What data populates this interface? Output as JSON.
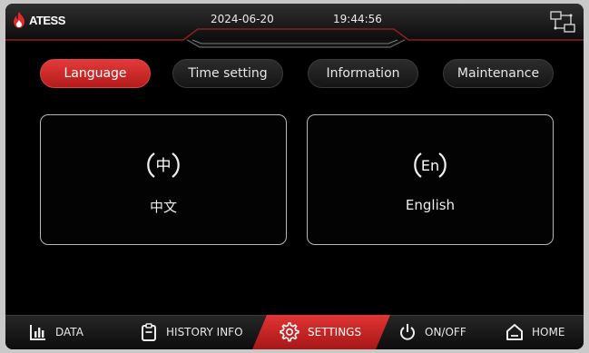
{
  "app": {
    "logo_text": "ATESS"
  },
  "status": {
    "date": "2024-06-20",
    "time": "19:44:56"
  },
  "icons": {
    "logo": "flame-icon",
    "network": "network-icon"
  },
  "tabs": [
    {
      "label": "Language",
      "active": true
    },
    {
      "label": "Time setting",
      "active": false
    },
    {
      "label": "Information",
      "active": false
    },
    {
      "label": "Maintenance",
      "active": false
    }
  ],
  "languages": [
    {
      "glyph": "中",
      "label": "中文"
    },
    {
      "glyph": "En",
      "label": "English"
    }
  ],
  "nav": [
    {
      "label": "DATA",
      "icon": "bar-chart-icon"
    },
    {
      "label": "HISTORY INFO",
      "icon": "clipboard-icon"
    },
    {
      "label": "SETTINGS",
      "icon": "gear-icon",
      "active": true
    },
    {
      "label": "ON/OFF",
      "icon": "power-icon"
    },
    {
      "label": "HOME",
      "icon": "home-icon"
    }
  ],
  "colors": {
    "accent": "#d92b2b",
    "background": "#000000",
    "text": "#e8e8e8"
  }
}
